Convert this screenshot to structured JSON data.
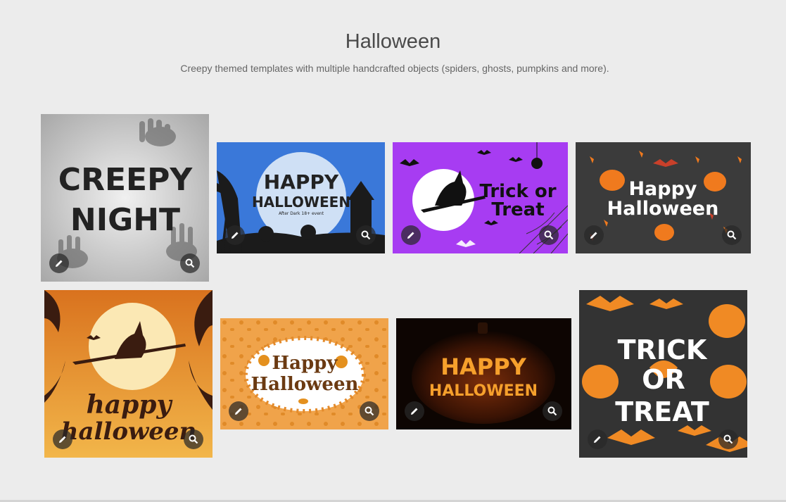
{
  "page": {
    "title": "Halloween",
    "subtitle": "Creepy themed templates with multiple handcrafted objects (spiders, ghosts, pumpkins and more)."
  },
  "templates": [
    {
      "name": "creepy-night",
      "lines": [
        "CREEPY",
        "NIGHT"
      ],
      "background": "#c4c4c4"
    },
    {
      "name": "happy-halloween-blue-moon",
      "lines": [
        "HAPPY",
        "HALLOWEEN",
        "After Dark 18+ event"
      ],
      "background": "#3a78d9"
    },
    {
      "name": "trick-or-treat-purple-witch",
      "lines": [
        "Trick or",
        "Treat"
      ],
      "background": "#a73cf2"
    },
    {
      "name": "happy-halloween-dark-pumpkins",
      "lines": [
        "Happy",
        "Halloween"
      ],
      "background": "#3a3a3a"
    },
    {
      "name": "happy-halloween-orange-witch",
      "lines": [
        "happy",
        "halloween"
      ],
      "background": "#e08a2c"
    },
    {
      "name": "happy-halloween-pattern-frame",
      "lines": [
        "Happy",
        "Halloween"
      ],
      "background": "#f0a34a"
    },
    {
      "name": "happy-halloween-carved-pumpkin",
      "lines": [
        "HAPPY",
        "HALLOWEEN"
      ],
      "background": "#1a0c05"
    },
    {
      "name": "trick-or-treat-grunge",
      "lines": [
        "TRICK",
        "OR",
        "TREAT"
      ],
      "background": "#333333"
    }
  ],
  "icons": {
    "edit": "pencil-icon",
    "preview": "magnifier-icon"
  },
  "colors": {
    "accent_orange": "#f08a24",
    "purple": "#a73cf2",
    "blue": "#3a78d9"
  }
}
